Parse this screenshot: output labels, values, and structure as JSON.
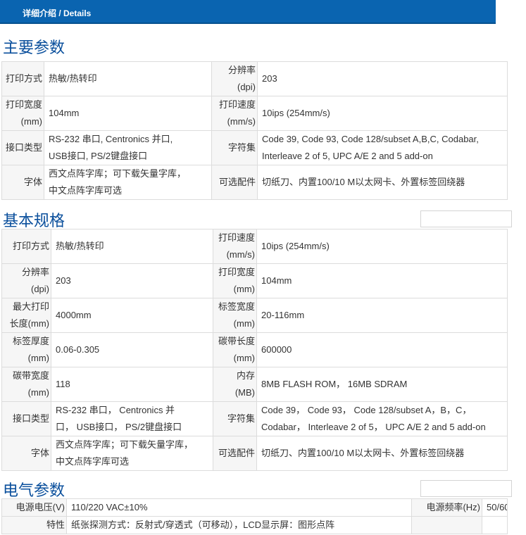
{
  "header": {
    "title": "详细介绍 / Details"
  },
  "main_params": {
    "title": "主要参数",
    "rows": [
      [
        "打印方式",
        "热敏/热转印",
        "分辨率\n(dpi)",
        "203"
      ],
      [
        "打印宽度\n(mm)",
        "104mm",
        "打印速度\n(mm/s)",
        "10ips (254mm/s)"
      ],
      [
        "接口类型",
        "RS-232 串口, Centronics 并口,\nUSB接口, PS/2键盘接口",
        "字符集",
        "Code 39, Code 93, Code 128/subset A,B,C, Codabar,\nInterleave 2 of 5, UPC A/E 2 and 5 add-on"
      ],
      [
        "字体",
        "西文点阵字库；可下载矢量字库，\n中文点阵字库可选",
        "可选配件",
        "切纸刀、内置100/10 M以太网卡、外置标签回绕器"
      ]
    ]
  },
  "basic_specs": {
    "title": "基本规格",
    "rows": [
      [
        "打印方式",
        "热敏/热转印",
        "打印速度\n(mm/s)",
        "10ips (254mm/s)"
      ],
      [
        "分辨率\n(dpi)",
        "203",
        "打印宽度\n(mm)",
        "104mm"
      ],
      [
        "最大打印\n长度(mm)",
        "4000mm",
        "标签宽度\n(mm)",
        "20-116mm"
      ],
      [
        "标签厚度\n(mm)",
        "0.06-0.305",
        "碳带长度\n(mm)",
        "600000"
      ],
      [
        "碳带宽度\n(mm)",
        "118",
        "内存\n(MB)",
        "8MB FLASH ROM， 16MB SDRAM"
      ],
      [
        "接口类型",
        "RS-232 串口， Centronics 并\n口， USB接口， PS/2键盘接口",
        "字符集",
        "Code 39， Code 93， Code 128/subset A，B，C，\nCodabar， Interleave 2 of 5， UPC A/E 2 and 5 add-on"
      ],
      [
        "字体",
        "西文点阵字库；可下载矢量字库，\n中文点阵字库可选",
        "可选配件",
        "切纸刀、内置100/10 M以太网卡、外置标签回绕器"
      ]
    ]
  },
  "electrical": {
    "title": "电气参数",
    "row1": {
      "label": "电源电压(V)",
      "value": "110/220 VAC±10%",
      "label2": "电源频率(Hz)",
      "value2": "50/60"
    },
    "row2": {
      "label": "特性",
      "value": "纸张探测方式：反射式/穿透式（可移动），LCD显示屏：图形点阵"
    }
  },
  "colors": {
    "header_bg": "#0a64b0",
    "title_text": "#0a4f9c",
    "label_bg": "#f6f6f6",
    "border": "#dcdcdc"
  }
}
